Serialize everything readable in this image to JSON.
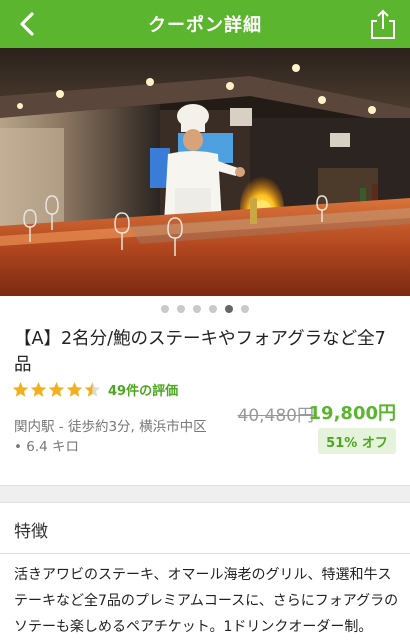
{
  "header": {
    "title": "クーポン詳細",
    "back_icon": "chevron-left-icon",
    "share_icon": "share-icon",
    "background": "#5bb52e"
  },
  "hero": {
    "alt": "teppanyaki-chef-flambe-photo",
    "carousel": {
      "count": 6,
      "active_index": 4
    }
  },
  "coupon": {
    "title": "【A】2名分/鮑のステーキやフォアグラなど全7品",
    "rating": {
      "value": 4.5,
      "max": 5,
      "reviews_text": "49件の評価"
    },
    "location": {
      "station": "関内駅",
      "walk": " - 徒歩約3分, 横浜市中区",
      "distance": "• 6.4 キロ"
    },
    "original_price": "40,480円",
    "price": "19,800円",
    "discount": "51% オフ"
  },
  "features": {
    "heading": "特徴",
    "text": "活きアワビのステーキ、オマール海老のグリル、特選和牛ステーキなど全7品のプレミアムコースに、さらにフォアグラのソテーも楽しめるペアチケット。1ドリンクオーダー制。"
  },
  "colors": {
    "accent": "#5bb52e",
    "star": "#f2b01e",
    "discount_bg": "#e5f3dc"
  }
}
